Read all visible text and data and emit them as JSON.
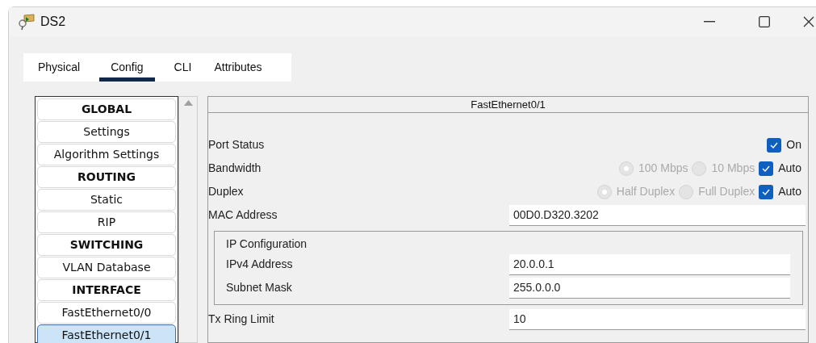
{
  "window": {
    "title": "DS2"
  },
  "tabs": [
    {
      "label": "Physical",
      "selected": false
    },
    {
      "label": "Config",
      "selected": true
    },
    {
      "label": "CLI",
      "selected": false
    },
    {
      "label": "Attributes",
      "selected": false
    }
  ],
  "sidebar": {
    "items": [
      {
        "label": "GLOBAL",
        "kind": "header",
        "selected": false
      },
      {
        "label": "Settings",
        "kind": "item",
        "selected": false
      },
      {
        "label": "Algorithm Settings",
        "kind": "item",
        "selected": false
      },
      {
        "label": "ROUTING",
        "kind": "header",
        "selected": false
      },
      {
        "label": "Static",
        "kind": "item",
        "selected": false
      },
      {
        "label": "RIP",
        "kind": "item",
        "selected": false
      },
      {
        "label": "SWITCHING",
        "kind": "header",
        "selected": false
      },
      {
        "label": "VLAN Database",
        "kind": "item",
        "selected": false
      },
      {
        "label": "INTERFACE",
        "kind": "header",
        "selected": false
      },
      {
        "label": "FastEthernet0/0",
        "kind": "item",
        "selected": false
      },
      {
        "label": "FastEthernet0/1",
        "kind": "item",
        "selected": true
      }
    ]
  },
  "panel": {
    "title": "FastEthernet0/1",
    "rows": [
      {
        "kind": "options",
        "label": "Port Status",
        "options": [
          {
            "kind": "checkbox",
            "label": "On",
            "checked": true,
            "disabled": false
          }
        ]
      },
      {
        "kind": "options",
        "label": "Bandwidth",
        "options": [
          {
            "kind": "radio",
            "label": "100 Mbps",
            "selected": true,
            "disabled": true
          },
          {
            "kind": "radio",
            "label": "10 Mbps",
            "selected": false,
            "disabled": true
          },
          {
            "kind": "checkbox",
            "label": "Auto",
            "checked": true,
            "disabled": false
          }
        ]
      },
      {
        "kind": "options",
        "label": "Duplex",
        "options": [
          {
            "kind": "radio",
            "label": "Half Duplex",
            "selected": true,
            "disabled": true
          },
          {
            "kind": "radio",
            "label": "Full Duplex",
            "selected": false,
            "disabled": true
          },
          {
            "kind": "checkbox",
            "label": "Auto",
            "checked": true,
            "disabled": false
          }
        ]
      },
      {
        "kind": "field",
        "label": "MAC Address",
        "value": "00D0.D320.3202"
      },
      {
        "kind": "group",
        "title": "IP Configuration",
        "fields": [
          {
            "label": "IPv4 Address",
            "value": "20.0.0.1"
          },
          {
            "label": "Subnet Mask",
            "value": "255.0.0.0"
          }
        ]
      },
      {
        "kind": "field",
        "label": "Tx Ring Limit",
        "value": "10"
      }
    ]
  }
}
